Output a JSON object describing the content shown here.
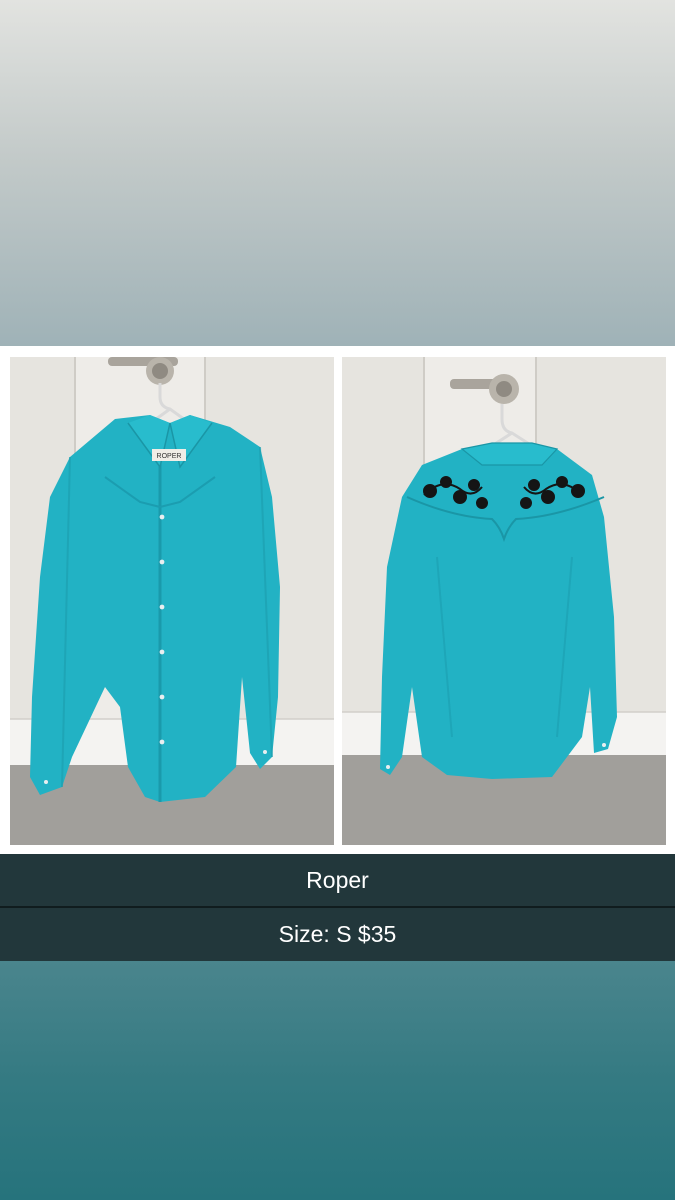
{
  "listing": {
    "brand": "Roper",
    "details": "Size: S $35"
  },
  "photos": [
    {
      "name": "shirt-front-photo",
      "label_on_tag": "ROPER"
    },
    {
      "name": "shirt-back-photo"
    }
  ],
  "colors": {
    "caption_bar": "#22373b",
    "shirt": "#22b2c4",
    "embroidery": "#151515",
    "top_band": "#c3cac9",
    "bottom_band": "#347a82"
  }
}
